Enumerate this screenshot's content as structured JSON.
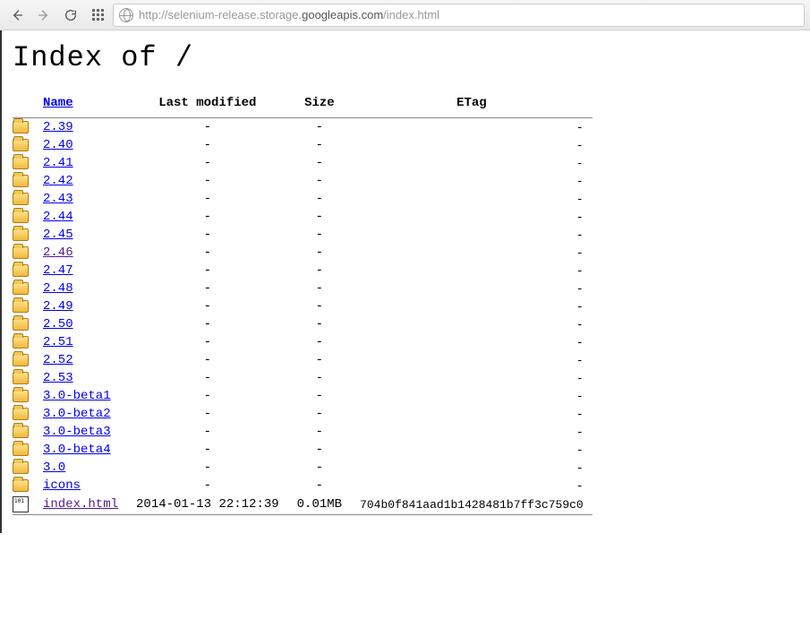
{
  "browser": {
    "url_plain_prefix": "http://selenium-release.storage.",
    "url_bold": "googleapis.com",
    "url_plain_suffix": "/index.html"
  },
  "page": {
    "title": "Index of /",
    "headers": {
      "name": "Name",
      "modified": "Last modified",
      "size": "Size",
      "etag": "ETag"
    },
    "entries": [
      {
        "icon": "folder",
        "name": "2.39",
        "modified": "-",
        "size": "-",
        "etag": "-",
        "visited": false
      },
      {
        "icon": "folder",
        "name": "2.40",
        "modified": "-",
        "size": "-",
        "etag": "-",
        "visited": false
      },
      {
        "icon": "folder",
        "name": "2.41",
        "modified": "-",
        "size": "-",
        "etag": "-",
        "visited": false
      },
      {
        "icon": "folder",
        "name": "2.42",
        "modified": "-",
        "size": "-",
        "etag": "-",
        "visited": false
      },
      {
        "icon": "folder",
        "name": "2.43",
        "modified": "-",
        "size": "-",
        "etag": "-",
        "visited": false
      },
      {
        "icon": "folder",
        "name": "2.44",
        "modified": "-",
        "size": "-",
        "etag": "-",
        "visited": false
      },
      {
        "icon": "folder",
        "name": "2.45",
        "modified": "-",
        "size": "-",
        "etag": "-",
        "visited": false
      },
      {
        "icon": "folder",
        "name": "2.46",
        "modified": "-",
        "size": "-",
        "etag": "-",
        "visited": true
      },
      {
        "icon": "folder",
        "name": "2.47",
        "modified": "-",
        "size": "-",
        "etag": "-",
        "visited": false
      },
      {
        "icon": "folder",
        "name": "2.48",
        "modified": "-",
        "size": "-",
        "etag": "-",
        "visited": false
      },
      {
        "icon": "folder",
        "name": "2.49",
        "modified": "-",
        "size": "-",
        "etag": "-",
        "visited": false
      },
      {
        "icon": "folder",
        "name": "2.50",
        "modified": "-",
        "size": "-",
        "etag": "-",
        "visited": false
      },
      {
        "icon": "folder",
        "name": "2.51",
        "modified": "-",
        "size": "-",
        "etag": "-",
        "visited": false
      },
      {
        "icon": "folder",
        "name": "2.52",
        "modified": "-",
        "size": "-",
        "etag": "-",
        "visited": false
      },
      {
        "icon": "folder",
        "name": "2.53",
        "modified": "-",
        "size": "-",
        "etag": "-",
        "visited": false
      },
      {
        "icon": "folder",
        "name": "3.0-beta1",
        "modified": "-",
        "size": "-",
        "etag": "-",
        "visited": false
      },
      {
        "icon": "folder",
        "name": "3.0-beta2",
        "modified": "-",
        "size": "-",
        "etag": "-",
        "visited": false
      },
      {
        "icon": "folder",
        "name": "3.0-beta3",
        "modified": "-",
        "size": "-",
        "etag": "-",
        "visited": false
      },
      {
        "icon": "folder",
        "name": "3.0-beta4",
        "modified": "-",
        "size": "-",
        "etag": "-",
        "visited": false
      },
      {
        "icon": "folder",
        "name": "3.0",
        "modified": "-",
        "size": "-",
        "etag": "-",
        "visited": false
      },
      {
        "icon": "folder",
        "name": "icons",
        "modified": "-",
        "size": "-",
        "etag": "-",
        "visited": false
      },
      {
        "icon": "file",
        "name": "index.html",
        "modified": "2014-01-13 22:12:39",
        "size": "0.01MB",
        "etag": "704b0f841aad1b1428481b7ff3c759c0",
        "visited": true
      }
    ]
  }
}
